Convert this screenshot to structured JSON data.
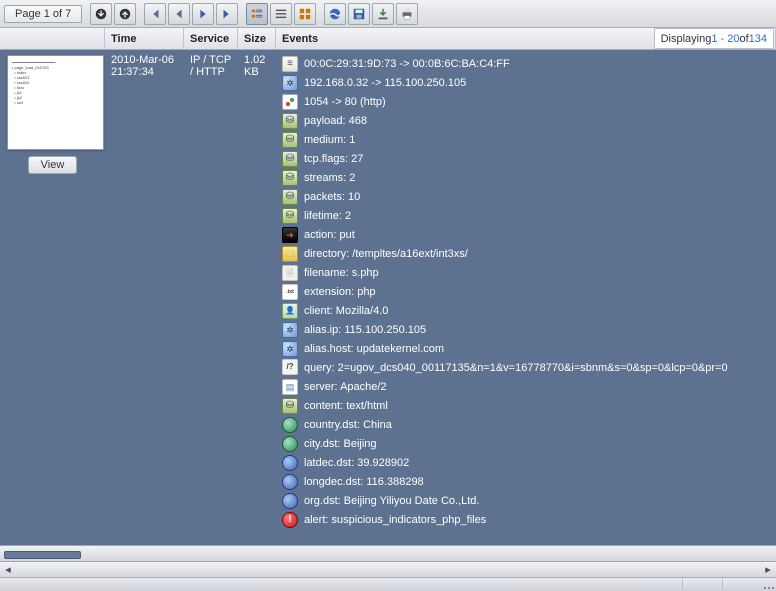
{
  "toolbar": {
    "page_text": "Page 1 of 7"
  },
  "columns": {
    "thumb": "",
    "time": "Time",
    "service": "Service",
    "size": "Size",
    "events": "Events"
  },
  "paging": {
    "prefix": "Displaying ",
    "range": "1 - 20",
    "of": " of ",
    "total": "134"
  },
  "record": {
    "time": "2010-Mar-06 21:37:34",
    "service": "IP / TCP / HTTP",
    "size": "1.02 KB",
    "view_label": "View"
  },
  "events": [
    {
      "icon": "doc",
      "text": "00:0C:29:31:9D:73 -> 00:0B:6C:BA:C4:FF"
    },
    {
      "icon": "net",
      "text": "192.168.0.32 -> 115.100.250.105"
    },
    {
      "icon": "traffic",
      "text": "1054 -> 80 (http)"
    },
    {
      "icon": "db",
      "text": "payload: 468"
    },
    {
      "icon": "db",
      "text": "medium: 1"
    },
    {
      "icon": "db",
      "text": "tcp.flags: 27"
    },
    {
      "icon": "db",
      "text": "streams: 2"
    },
    {
      "icon": "db",
      "text": "packets: 10"
    },
    {
      "icon": "db",
      "text": "lifetime: 2"
    },
    {
      "icon": "arrow",
      "text": "action: put"
    },
    {
      "icon": "folder",
      "text": "directory: /templtes/a16ext/int3xs/"
    },
    {
      "icon": "file",
      "text": "filename: s.php"
    },
    {
      "icon": "txt",
      "text": "extension: php"
    },
    {
      "icon": "client",
      "text": "client: Mozilla/4.0"
    },
    {
      "icon": "net",
      "text": "alias.ip: 115.100.250.105"
    },
    {
      "icon": "net",
      "text": "alias.host: updatekernel.com"
    },
    {
      "icon": "q",
      "text": "query: 2=ugov_dcs040_00117135&n=1&v=16778770&i=sbnm&s=0&sp=0&lcp=0&pr=0",
      "wrap": true
    },
    {
      "icon": "server",
      "text": "server: Apache/2"
    },
    {
      "icon": "db",
      "text": "content: text/html"
    },
    {
      "icon": "globe",
      "text": "country.dst: China"
    },
    {
      "icon": "globe",
      "text": "city.dst: Beijing"
    },
    {
      "icon": "globe2",
      "text": "latdec.dst: 39.928902"
    },
    {
      "icon": "globe2",
      "text": "longdec.dst: 116.388298"
    },
    {
      "icon": "globe2",
      "text": "org.dst: Beijing Yiliyou Date Co.,Ltd."
    },
    {
      "icon": "alert",
      "text": "alert: suspicious_indicators_php_files"
    }
  ]
}
